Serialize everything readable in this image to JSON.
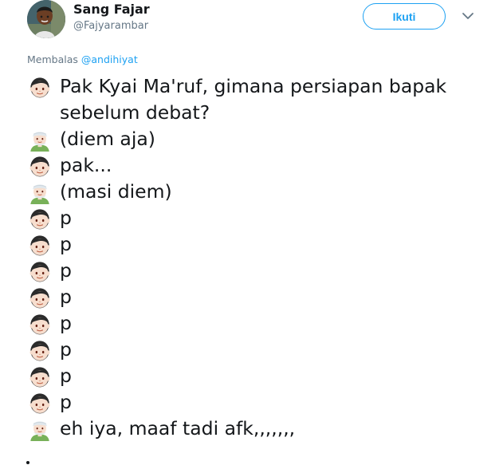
{
  "tweet": {
    "author_name": "Sang Fajar",
    "author_handle": "@Fajyarambar",
    "follow_label": "Ikuti",
    "reply_prefix": "Membalas",
    "reply_to": "@andihiyat",
    "lines": [
      {
        "icon": "boy-emoji-icon",
        "text": "Pak Kyai Ma'ruf, gimana persiapan bapak sebelum debat?"
      },
      {
        "icon": "man-with-turban-emoji-icon",
        "text": "(diem aja)"
      },
      {
        "icon": "boy-emoji-icon",
        "text": "pak..."
      },
      {
        "icon": "man-with-turban-emoji-icon",
        "text": "(masi diem)"
      },
      {
        "icon": "boy-emoji-icon",
        "text": "p"
      },
      {
        "icon": "boy-emoji-icon",
        "text": "p"
      },
      {
        "icon": "boy-emoji-icon",
        "text": "p"
      },
      {
        "icon": "boy-emoji-icon",
        "text": "p"
      },
      {
        "icon": "boy-emoji-icon",
        "text": "p"
      },
      {
        "icon": "boy-emoji-icon",
        "text": "p"
      },
      {
        "icon": "boy-emoji-icon",
        "text": "p"
      },
      {
        "icon": "boy-emoji-icon",
        "text": "p"
      },
      {
        "icon": "man-with-turban-emoji-icon",
        "text": "eh iya, maaf tadi afk,,,,,,,"
      }
    ]
  },
  "colors": {
    "accent": "#1da1f2",
    "secondary_text": "#657786",
    "primary_text": "#14171a"
  }
}
